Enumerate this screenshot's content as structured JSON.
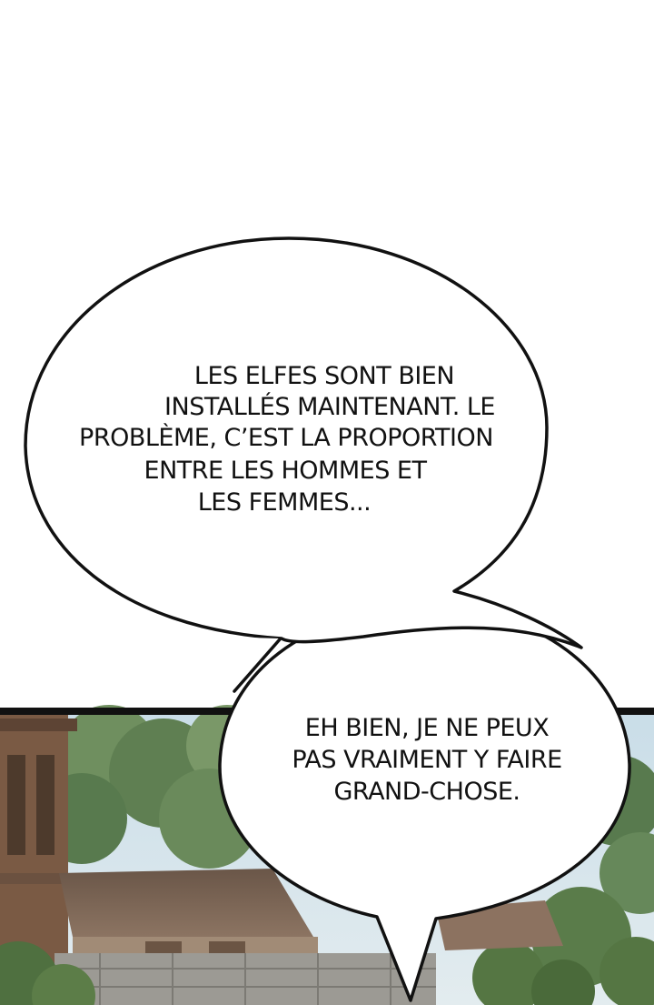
{
  "panel": {
    "background_top": "#ffffff",
    "border_color": "#111111",
    "speech_bubbles": [
      {
        "lines": [
          "LES ELFES SONT BIEN",
          "INSTALLÉS MAINTENANT. LE",
          "PROBLÈME, C’EST LA PROPORTION",
          "ENTRE LES HOMMES ET",
          "LES FEMMES..."
        ]
      },
      {
        "lines": [
          "EH BIEN, JE NE PEUX",
          "PAS VRAIMENT Y FAIRE",
          "GRAND-CHOSE."
        ]
      }
    ]
  }
}
